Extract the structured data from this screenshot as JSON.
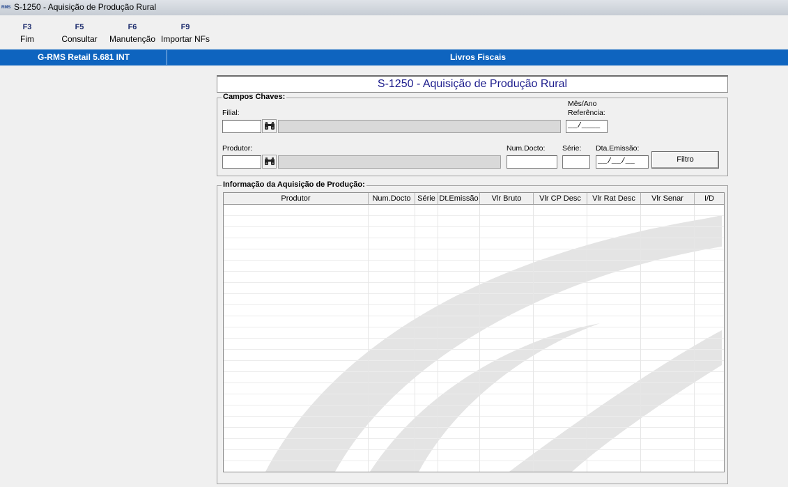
{
  "window": {
    "title": "S-1250 - Aquisição de Produção Rural",
    "app_icon": "RMS"
  },
  "toolbar": {
    "items": [
      {
        "key": "F3",
        "label": "Fim"
      },
      {
        "key": "F5",
        "label": "Consultar"
      },
      {
        "key": "F6",
        "label": "Manutenção"
      },
      {
        "key": "F9",
        "label": "Importar NFs"
      }
    ]
  },
  "status_bar": {
    "left": "G-RMS Retail 5.681 INT",
    "right": "Livros Fiscais"
  },
  "form": {
    "title": "S-1250 - Aquisição de Produção Rural",
    "campos_chaves": {
      "legend": "Campos Chaves:",
      "filial_label": "Filial:",
      "filial_value": "",
      "filial_desc": "",
      "mes_ano_label1": "Mês/Ano",
      "mes_ano_label2": "Referência:",
      "mes_ano_value": "__/____",
      "produtor_label": "Produtor:",
      "produtor_value": "",
      "produtor_desc": "",
      "num_docto_label": "Num.Docto:",
      "num_docto_value": "",
      "serie_label": "Série:",
      "serie_value": "",
      "dta_emissao_label": "Dta.Emissão:",
      "dta_emissao_value": "__/__/__",
      "filtro_button": "Filtro"
    },
    "informacao": {
      "legend": "Informação da Aquisição de Produção:",
      "columns": [
        "Produtor",
        "Num.Docto",
        "Série",
        "Dt.Emissão",
        "Vlr Bruto",
        "Vlr CP Desc",
        "Vlr Rat Desc",
        "Vlr Senar",
        "I/D"
      ],
      "rows": []
    }
  },
  "colors": {
    "accent_bar": "#0e64bf",
    "title_text": "#1c1c8c",
    "toolbar_key": "#1a2a6c"
  },
  "icons": {
    "lookup": "binoculars-icon"
  }
}
